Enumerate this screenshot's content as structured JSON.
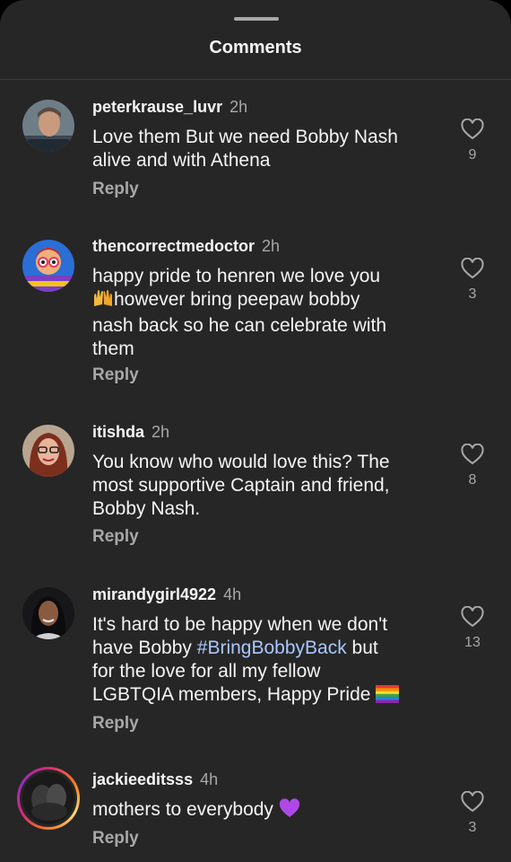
{
  "header": {
    "title": "Comments"
  },
  "reply_label": "Reply",
  "comments": [
    {
      "username": "peterkrause_luvr",
      "time": "2h",
      "lines": [
        "Love them But we need Bobby Nash",
        "alive and with Athena"
      ],
      "likes": "9",
      "avatar": "man-portrait"
    },
    {
      "username": "thencorrectmedoctor",
      "time": "2h",
      "line1": "happy pride to henren we love you",
      "line2_emoji": "raising-hands-emoji",
      "line2": "however bring peepaw bobby",
      "line3": "nash back so he can celebrate with",
      "line4": "them",
      "likes": "3",
      "avatar": "pride-cartoon"
    },
    {
      "username": "itishda",
      "time": "2h",
      "lines": [
        "You know who would love this? The",
        "most supportive Captain and friend,",
        "Bobby Nash."
      ],
      "likes": "8",
      "avatar": "woman-glasses"
    },
    {
      "username": "mirandygirl4922",
      "time": "4h",
      "line1": "It's hard to be happy when we don't",
      "line2_pre": "have Bobby ",
      "line2_hashtag": "#BringBobbyBack",
      "line2_post": " but",
      "line3": "for the love for all my fellow",
      "line4": "LGBTQIA members, Happy Pride",
      "line4_emoji": "rainbow-flag-emoji",
      "likes": "13",
      "avatar": "woman-portrait"
    },
    {
      "username": "jackieeditsss",
      "time": "4h",
      "line1": "mothers to everybody",
      "line1_emoji": "purple-heart-emoji",
      "likes": "3",
      "avatar": "dark-photo-story-ring"
    }
  ],
  "colors": {
    "background": "#262626",
    "text": "#f5f5f5",
    "muted": "#a8a8a8",
    "hashtag": "#a9c8ff"
  }
}
